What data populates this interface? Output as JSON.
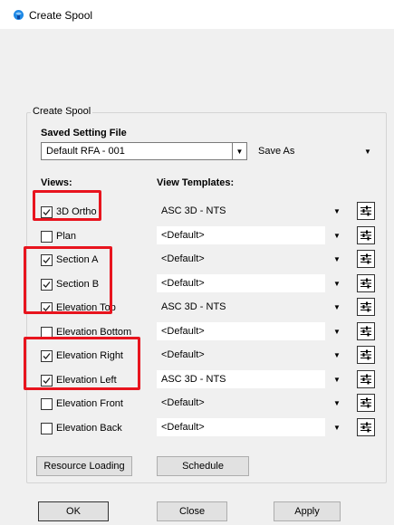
{
  "window": {
    "title": "Create Spool",
    "icon": "spool-app-icon"
  },
  "group": {
    "label": "Create Spool"
  },
  "saved_setting": {
    "heading": "Saved Setting File",
    "selected": "Default RFA - 001",
    "save_as_value": "Save As"
  },
  "headers": {
    "views": "Views:",
    "templates": "View Templates:"
  },
  "rows": [
    {
      "label": "3D Ortho",
      "checked": true,
      "template": "ASC 3D - NTS",
      "style": "gray"
    },
    {
      "label": "Plan",
      "checked": false,
      "template": "<Default>",
      "style": "white"
    },
    {
      "label": "Section A",
      "checked": true,
      "template": "<Default>",
      "style": "gray"
    },
    {
      "label": "Section B",
      "checked": true,
      "template": "<Default>",
      "style": "white"
    },
    {
      "label": "Elevation Top",
      "checked": true,
      "template": "ASC 3D - NTS",
      "style": "gray"
    },
    {
      "label": "Elevation Bottom",
      "checked": false,
      "template": "<Default>",
      "style": "white"
    },
    {
      "label": "Elevation Right",
      "checked": true,
      "template": "<Default>",
      "style": "gray"
    },
    {
      "label": "Elevation Left",
      "checked": true,
      "template": "ASC 3D - NTS",
      "style": "white"
    },
    {
      "label": "Elevation Front",
      "checked": false,
      "template": "<Default>",
      "style": "gray"
    },
    {
      "label": "Elevation Back",
      "checked": false,
      "template": "<Default>",
      "style": "white"
    }
  ],
  "buttons": {
    "resource_loading": "Resource Loading",
    "schedule": "Schedule",
    "ok": "OK",
    "close": "Close",
    "apply": "Apply"
  },
  "colors": {
    "highlight": "#e8141e",
    "gray_row": "#c8c8c8"
  }
}
